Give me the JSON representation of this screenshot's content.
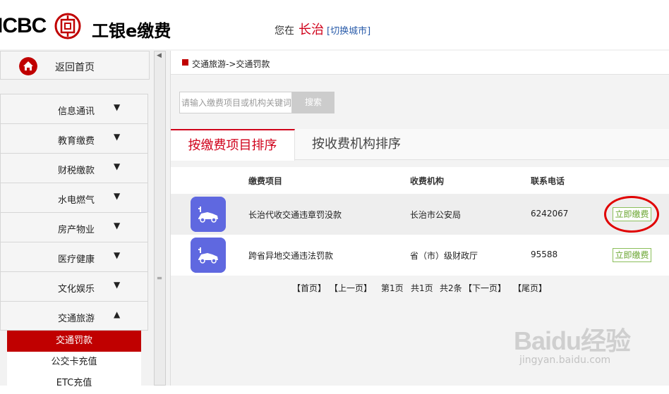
{
  "header": {
    "logo_text": "ICBC",
    "logo_sub": "工银e缴费",
    "city_prefix": "您在",
    "city_name": "长治",
    "city_switch": "[切换城市]"
  },
  "sidebar": {
    "home_label": "返回首页",
    "items": [
      {
        "label": "信息通讯",
        "arrow": "▼"
      },
      {
        "label": "教育缴费",
        "arrow": "▼"
      },
      {
        "label": "财税缴款",
        "arrow": "▼"
      },
      {
        "label": "水电燃气",
        "arrow": "▼"
      },
      {
        "label": "房产物业",
        "arrow": "▼"
      },
      {
        "label": "医疗健康",
        "arrow": "▼"
      },
      {
        "label": "文化娱乐",
        "arrow": "▼"
      },
      {
        "label": "交通旅游",
        "arrow": "▲"
      }
    ],
    "sub_items": [
      {
        "label": "交通罚款",
        "active": true
      },
      {
        "label": "公交卡充值",
        "active": false
      },
      {
        "label": "ETC充值",
        "active": false
      }
    ]
  },
  "main": {
    "breadcrumb": "交通旅游->交通罚款",
    "search": {
      "placeholder": "请输入缴费项目或机构关键词",
      "button": "搜索"
    },
    "tabs": [
      {
        "label": "按缴费项目排序",
        "active": true
      },
      {
        "label": "按收费机构排序",
        "active": false
      }
    ],
    "table": {
      "headers": [
        "缴费项目",
        "收费机构",
        "联系电话"
      ],
      "rows": [
        {
          "item": "长治代收交通违章罚没款",
          "org": "长治市公安局",
          "phone": "6242067",
          "action": "立即缴费"
        },
        {
          "item": "跨省异地交通违法罚款",
          "org": "省（市）级财政厅",
          "phone": "95588",
          "action": "立即缴费"
        }
      ]
    },
    "pager": {
      "first": "【首页】",
      "prev": "【上一页】",
      "page": "第1页",
      "total_pages": "共1页",
      "total_items": "共2条",
      "next": "【下一页】",
      "last": "【尾页】"
    }
  },
  "watermark": {
    "brand": "Baidu经验",
    "url": "jingyan.baidu.com"
  },
  "colors": {
    "brand_red": "#c00000",
    "accent_red": "#d0021b",
    "pay_green": "#6aa531",
    "icon_blue": "#5a5fd6"
  }
}
